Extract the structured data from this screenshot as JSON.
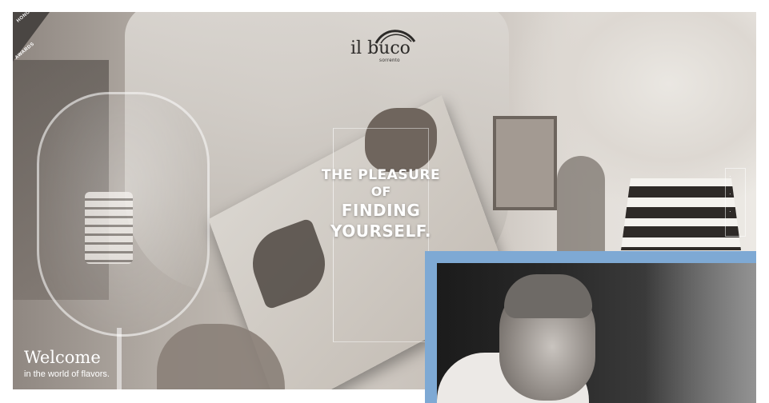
{
  "badge": {
    "top": "HONORS",
    "bottom": "AWARDS"
  },
  "logo": {
    "name": "il buco",
    "sub": "sorrento"
  },
  "headline": {
    "line1": "THE PLEASURE",
    "line2": "OF",
    "line3": "FINDING",
    "line4": "YOURSELF."
  },
  "welcome": {
    "title": "Welcome",
    "subtitle": "in the world of flavors."
  },
  "colors": {
    "chef_frame": "#7ea9d4",
    "text_light": "#ffffff",
    "logo_dark": "#2c2a28"
  }
}
